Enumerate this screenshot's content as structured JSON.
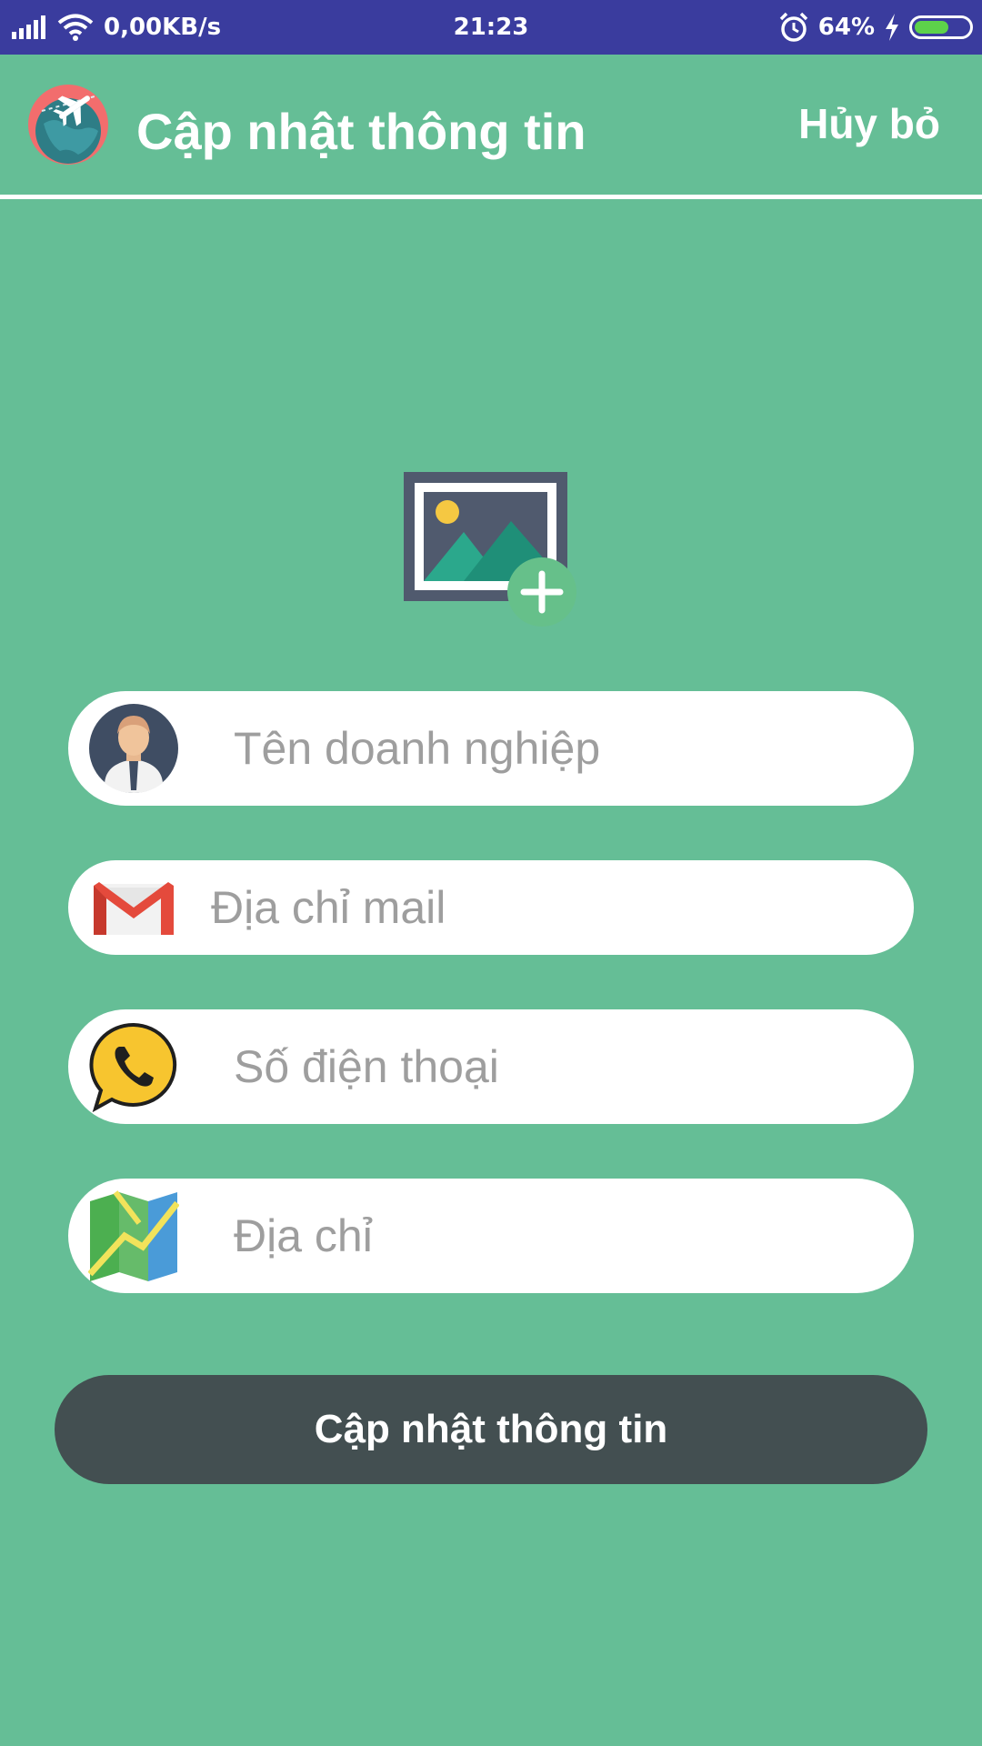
{
  "status_bar": {
    "network_speed": "0,00KB/s",
    "time": "21:23",
    "battery_percent": "64%",
    "battery_level": 0.64,
    "icons": [
      "signal-icon",
      "wifi-icon",
      "alarm-icon",
      "charging-icon",
      "battery-icon"
    ]
  },
  "header": {
    "title": "Cập nhật thông tin",
    "cancel_label": "Hủy bỏ",
    "logo_icon": "globe-plane-logo"
  },
  "image_picker": {
    "icon": "add-image-icon"
  },
  "form": {
    "company_name": {
      "placeholder": "Tên doanh nghiệp",
      "value": "",
      "icon": "businessman-avatar-icon"
    },
    "email": {
      "placeholder": "Địa chỉ mail",
      "value": "",
      "icon": "gmail-icon"
    },
    "phone": {
      "placeholder": "Số điện thoại",
      "value": "",
      "icon": "phone-icon"
    },
    "address": {
      "placeholder": "Địa chỉ",
      "value": "",
      "icon": "map-icon"
    }
  },
  "submit": {
    "label": "Cập nhật thông tin"
  },
  "colors": {
    "background": "#65BE96",
    "status_bar": "#3A3C9E",
    "button": "#434F51",
    "input_bg": "#FFFFFF",
    "placeholder": "#9E9E9E"
  }
}
